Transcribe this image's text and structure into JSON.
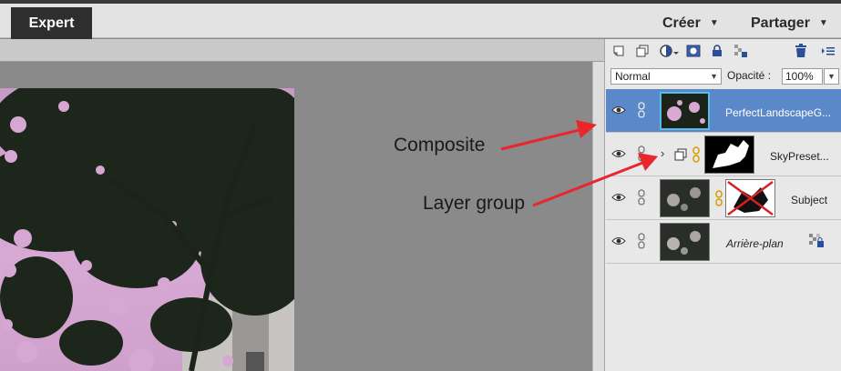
{
  "topbar": {
    "mode_tab": "Expert",
    "create_label": "Créer",
    "share_label": "Partager"
  },
  "layers_panel": {
    "blend_mode": "Normal",
    "opacity_label": "Opacité :",
    "opacity_value": "100%",
    "layers": [
      {
        "name": "PerfectLandscapeG...",
        "selected": true
      },
      {
        "name": "SkyPreset..."
      },
      {
        "name": "Subject"
      },
      {
        "name": "Arrière-plan"
      }
    ]
  },
  "annotations": {
    "composite": "Composite",
    "layer_group": "Layer group",
    "arrow_color": "#e8262b"
  },
  "colors": {
    "selected_layer": "#5b88c9",
    "expert_tab": "#2e2e2e"
  },
  "icons": [
    "new-layer-icon",
    "new-group-icon",
    "adjustment-layer-icon",
    "layer-mask-icon",
    "lock-icon",
    "lock-transparency-icon",
    "trash-icon",
    "panel-menu-icon",
    "eye-icon",
    "link-icon",
    "chevron-right-icon",
    "group-icon"
  ]
}
